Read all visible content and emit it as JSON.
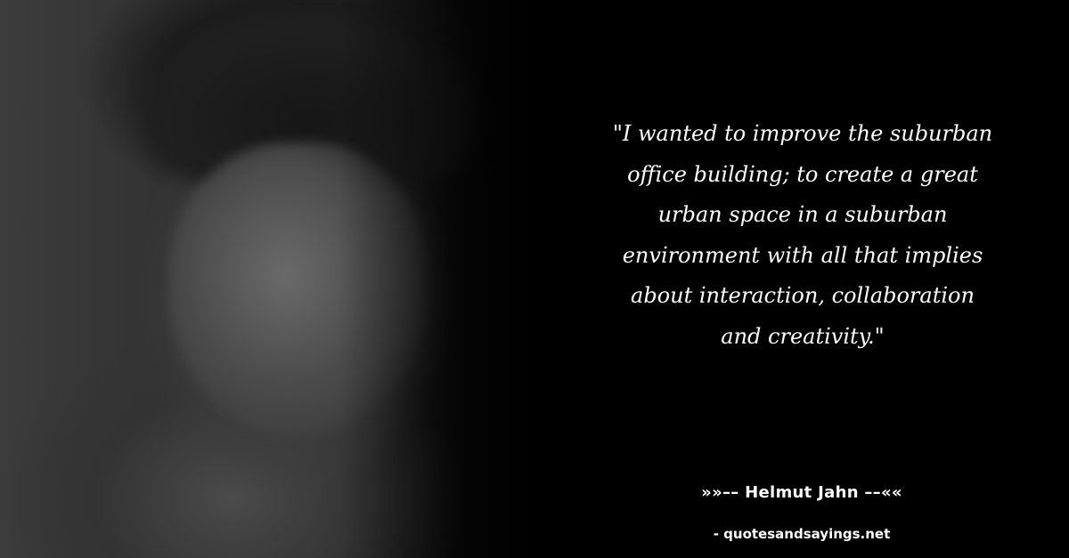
{
  "quote": {
    "lines": [
      "\"I wanted to improve the suburban",
      "office building; to create a great",
      "urban space in a suburban",
      "environment with all that implies",
      "about interaction, collaboration",
      "and creativity.\""
    ]
  },
  "author": {
    "label": "»»–– Helmut Jahn ––««"
  },
  "source": {
    "label": "- quotesandsayings.net"
  }
}
